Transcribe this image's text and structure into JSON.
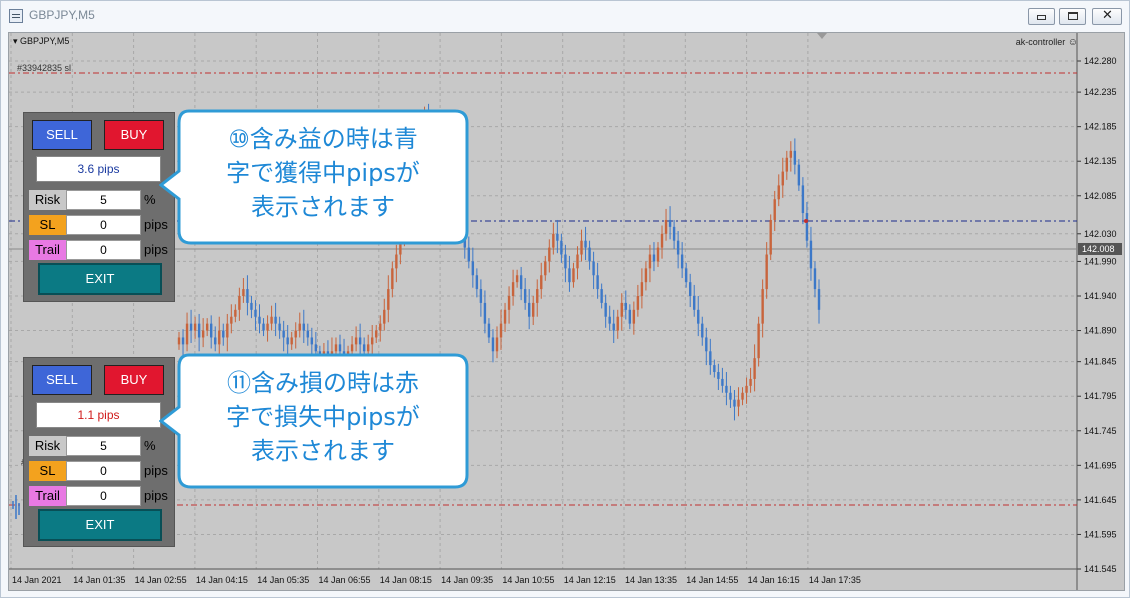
{
  "window": {
    "title": "GBPJPY,M5",
    "controls": {
      "minimize_icon": "minimize-icon",
      "maximize_icon": "maximize-icon",
      "close_icon": "close-icon"
    }
  },
  "chart": {
    "symbol_label": "GBPJPY,M5",
    "expert_label": "ak-controller",
    "order_label": "#33942835 sl",
    "order_label_short": "#33942835",
    "current_price": "142.008",
    "price_ticks": [
      "142.280",
      "142.235",
      "142.185",
      "142.135",
      "142.085",
      "142.030",
      "141.990",
      "141.940",
      "141.890",
      "141.845",
      "141.795",
      "141.745",
      "141.695",
      "141.645",
      "141.595",
      "141.545"
    ],
    "time_ticks": [
      "14 Jan 2021",
      "14 Jan 01:35",
      "14 Jan 02:55",
      "14 Jan 04:15",
      "14 Jan 05:35",
      "14 Jan 06:55",
      "14 Jan 08:15",
      "14 Jan 09:35",
      "14 Jan 10:55",
      "14 Jan 12:15",
      "14 Jan 13:35",
      "14 Jan 14:55",
      "14 Jan 16:15",
      "14 Jan 17:35"
    ],
    "colors": {
      "background": "#c8c8c8",
      "grid": "#a8a8a8",
      "bull": "#c8643c",
      "bear": "#3c78c8",
      "sl_line": "#c03030",
      "entry_line": "#1a2a8c"
    }
  },
  "chart_data": {
    "type": "candlestick",
    "ylim": [
      141.545,
      142.28
    ],
    "closes": [
      141.88,
      141.87,
      141.9,
      141.89,
      141.9,
      141.88,
      141.89,
      141.9,
      141.88,
      141.87,
      141.89,
      141.88,
      141.9,
      141.91,
      141.92,
      141.94,
      141.95,
      141.93,
      141.92,
      141.91,
      141.9,
      141.89,
      141.9,
      141.91,
      141.9,
      141.89,
      141.88,
      141.87,
      141.88,
      141.89,
      141.9,
      141.89,
      141.88,
      141.87,
      141.86,
      141.85,
      141.86,
      141.85,
      141.86,
      141.87,
      141.86,
      141.85,
      141.86,
      141.87,
      141.88,
      141.87,
      141.86,
      141.87,
      141.88,
      141.89,
      141.9,
      141.92,
      141.95,
      141.98,
      142.0,
      142.02,
      142.05,
      142.08,
      142.1,
      142.12,
      142.15,
      142.2,
      142.19,
      142.17,
      142.15,
      142.13,
      142.11,
      142.09,
      142.07,
      142.05,
      142.03,
      142.01,
      141.99,
      141.97,
      141.95,
      141.93,
      141.9,
      141.88,
      141.86,
      141.88,
      141.9,
      141.92,
      141.94,
      141.96,
      141.97,
      141.95,
      141.93,
      141.91,
      141.93,
      141.95,
      141.97,
      141.99,
      142.01,
      142.03,
      142.02,
      142.0,
      141.98,
      141.96,
      141.98,
      142.0,
      142.02,
      142.01,
      141.99,
      141.97,
      141.95,
      141.93,
      141.91,
      141.9,
      141.89,
      141.91,
      141.93,
      141.92,
      141.9,
      141.92,
      141.94,
      141.96,
      141.98,
      142.0,
      141.99,
      142.01,
      142.03,
      142.05,
      142.04,
      142.02,
      142.0,
      141.98,
      141.96,
      141.94,
      141.92,
      141.9,
      141.88,
      141.86,
      141.84,
      141.83,
      141.82,
      141.81,
      141.8,
      141.79,
      141.78,
      141.79,
      141.8,
      141.81,
      141.82,
      141.85,
      141.9,
      141.95,
      142.0,
      142.05,
      142.08,
      142.1,
      142.12,
      142.14,
      142.15,
      142.13,
      142.1,
      142.06,
      142.02,
      141.98,
      141.95,
      141.92
    ]
  },
  "panels": [
    {
      "sell_label": "SELL",
      "buy_label": "BUY",
      "pips_text": "3.6 pips",
      "pips_color": "#1a3aa0",
      "risk_label": "Risk",
      "risk_value": "5",
      "risk_unit": "%",
      "sl_label": "SL",
      "sl_value": "0",
      "sl_unit": "pips",
      "trail_label": "Trail",
      "trail_value": "0",
      "trail_unit": "pips",
      "exit_label": "EXIT"
    },
    {
      "sell_label": "SELL",
      "buy_label": "BUY",
      "pips_text": "1.1 pips",
      "pips_color": "#d01a1a",
      "risk_label": "Risk",
      "risk_value": "5",
      "risk_unit": "%",
      "sl_label": "SL",
      "sl_value": "0",
      "sl_unit": "pips",
      "trail_label": "Trail",
      "trail_value": "0",
      "trail_unit": "pips",
      "exit_label": "EXIT"
    }
  ],
  "callouts": [
    {
      "lines": [
        "⑩含み益の時は青",
        "字で獲得中pipsが",
        "表示されます"
      ]
    },
    {
      "lines": [
        "⑪含み損の時は赤",
        "字で損失中pipsが",
        "表示されます"
      ]
    }
  ]
}
